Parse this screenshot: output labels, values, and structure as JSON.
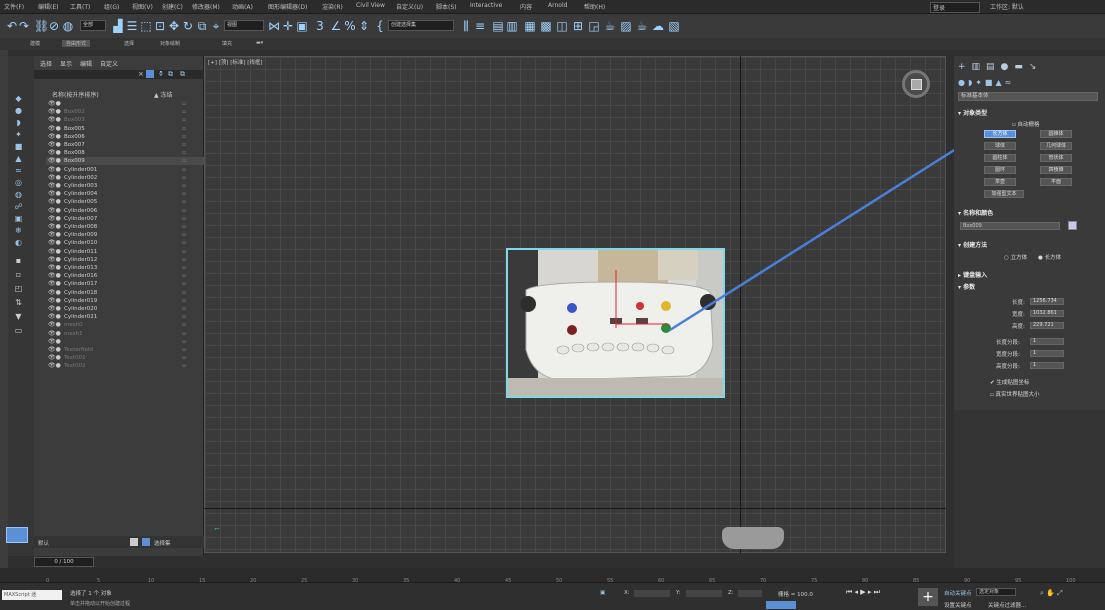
{
  "menubar": {
    "items": [
      "文件(F)",
      "编辑(E)",
      "工具(T)",
      "组(G)",
      "视图(V)",
      "创建(C)",
      "修改器(M)",
      "动画(A)",
      "图形编辑器(D)",
      "渲染(R)",
      "Civil View",
      "自定义(U)",
      "脚本(S)",
      "Interactive",
      "内容",
      "Arnold",
      "帮助(H)"
    ],
    "workspace_label": "工作区: 默认",
    "login": "登录"
  },
  "toolbar": {
    "all_filter": "全部",
    "view_select": "视图",
    "named_selection": "创建选择集"
  },
  "ribbon": {
    "tabs": [
      "建模",
      "自由形式",
      "选择",
      "对象绘制",
      "填充"
    ]
  },
  "scene_explorer": {
    "tabs": [
      "选择",
      "显示",
      "编辑",
      "自定义"
    ],
    "col_name": "名称(按升序排序)",
    "col_frozen": "▲ 冻结",
    "rows": [
      {
        "name": "",
        "dim": false
      },
      {
        "name": "Box002",
        "dim": true
      },
      {
        "name": "Box003",
        "dim": true
      },
      {
        "name": "Box005",
        "dim": false
      },
      {
        "name": "Box006",
        "dim": false
      },
      {
        "name": "Box007",
        "dim": false
      },
      {
        "name": "Box008",
        "dim": false
      },
      {
        "name": "Box009",
        "dim": false,
        "sel": true
      },
      {
        "name": "Cylinder001",
        "dim": false
      },
      {
        "name": "Cylinder002",
        "dim": false
      },
      {
        "name": "Cylinder003",
        "dim": false
      },
      {
        "name": "Cylinder004",
        "dim": false
      },
      {
        "name": "Cylinder005",
        "dim": false
      },
      {
        "name": "Cylinder006",
        "dim": false
      },
      {
        "name": "Cylinder007",
        "dim": false
      },
      {
        "name": "Cylinder008",
        "dim": false
      },
      {
        "name": "Cylinder009",
        "dim": false
      },
      {
        "name": "Cylinder010",
        "dim": false
      },
      {
        "name": "Cylinder011",
        "dim": false
      },
      {
        "name": "Cylinder012",
        "dim": false
      },
      {
        "name": "Cylinder013",
        "dim": false
      },
      {
        "name": "Cylinder016",
        "dim": false
      },
      {
        "name": "Cylinder017",
        "dim": false
      },
      {
        "name": "Cylinder018",
        "dim": false
      },
      {
        "name": "Cylinder019",
        "dim": false
      },
      {
        "name": "Cylinder020",
        "dim": false
      },
      {
        "name": "Cylinder021",
        "dim": false
      },
      {
        "name": "mesh0",
        "dim": true
      },
      {
        "name": "mesh1",
        "dim": true
      },
      {
        "name": "",
        "dim": true
      },
      {
        "name": "Teeterfield",
        "dim": true
      },
      {
        "name": "Text001",
        "dim": true
      },
      {
        "name": "Text002",
        "dim": true
      }
    ],
    "layer_label": "默认",
    "selection_set": "选择集"
  },
  "viewport": {
    "label": "[+] [顶] [标准] [线框]"
  },
  "command_panel": {
    "dropdown": "标准基本体",
    "object_type_title": "对象类型",
    "autogrid": "自动栅格",
    "buttons": [
      "长方体",
      "圆锥体",
      "球体",
      "几何球体",
      "圆柱体",
      "管状体",
      "圆环",
      "四棱锥",
      "茶壶",
      "平面",
      "加强型文本"
    ],
    "name_color_title": "名称和颜色",
    "object_name": "Box009",
    "creation_method_title": "创建方法",
    "cm_cube": "立方体",
    "cm_box": "长方体",
    "keyboard_title": "键盘输入",
    "params_title": "参数",
    "length_label": "长度:",
    "length_val": "1256.734",
    "width_label": "宽度:",
    "width_val": "1032.861",
    "height_label": "高度:",
    "height_val": "229.721",
    "lseg_label": "长度分段:",
    "lseg_val": "1",
    "wseg_label": "宽度分段:",
    "wseg_val": "1",
    "hseg_label": "高度分段:",
    "hseg_val": "1",
    "gen_map": "生成贴图坐标",
    "real_world": "真实世界贴图大小"
  },
  "timeline": {
    "frame_counter": "0 / 100",
    "ticks": [
      "0",
      "5",
      "10",
      "15",
      "20",
      "25",
      "30",
      "35",
      "40",
      "45",
      "50",
      "55",
      "60",
      "65",
      "70",
      "75",
      "80",
      "85",
      "90",
      "95",
      "100"
    ]
  },
  "statusbar": {
    "maxscript": "MAXScript 迷",
    "selected": "选择了 1 个 对象",
    "hint": "单击并拖动以开始创建过程",
    "x_label": "X:",
    "y_label": "Y:",
    "z_label": "Z:",
    "grid": "栅格 = 100.0",
    "autokey": "自动关键点",
    "selected_obj": "选定对象",
    "set_key": "设置关键点",
    "key_filter": "关键点过滤器..."
  }
}
